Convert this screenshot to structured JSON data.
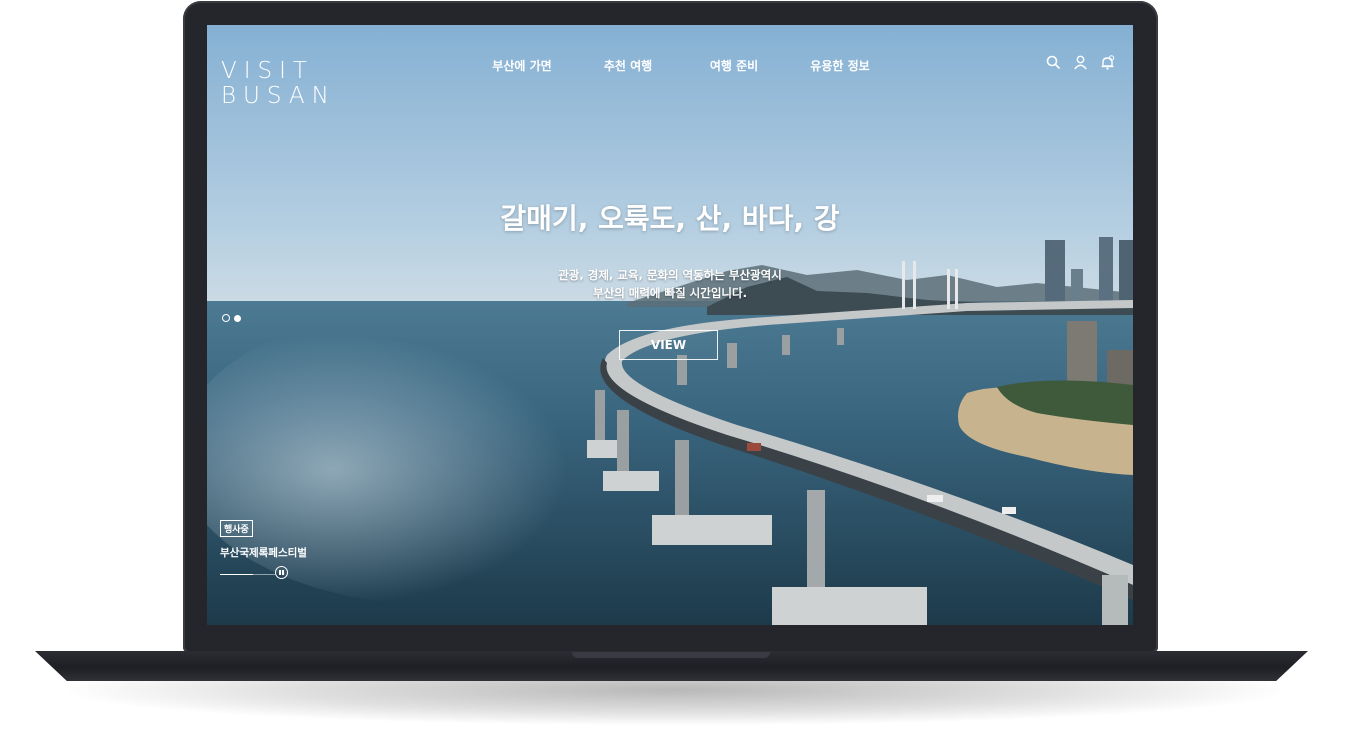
{
  "site": {
    "logo_line1": "VISIT",
    "logo_line2": "BUSAN"
  },
  "nav": {
    "items": [
      "부산에 가면",
      "추천 여행",
      "여행 준비",
      "유용한 정보"
    ]
  },
  "utility_icons": [
    "search-icon",
    "user-icon",
    "bell-icon"
  ],
  "hero": {
    "title": "갈매기, 오륙도, 산, 바다, 강",
    "subtitle_line1": "관광, 경제, 교육, 문화의 역동하는 부산광역시",
    "subtitle_line2": "부산의 매력에 빠질 시간입니다.",
    "button_label": "VIEW",
    "slide_count": 2,
    "active_slide": 1
  },
  "event": {
    "badge": "행사중",
    "title": "부산국제록페스티벌",
    "progress": 0.6
  },
  "colors": {
    "bezel": "#25262b",
    "text": "#ffffff",
    "sky": "#8fb6d6",
    "sea": "#2e5468"
  }
}
